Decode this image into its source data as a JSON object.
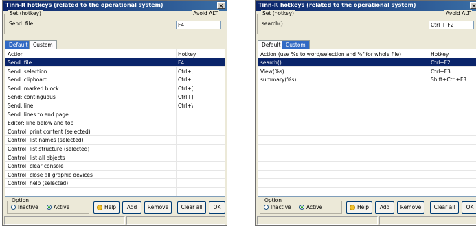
{
  "windows": [
    {
      "title": "Tinn-R hotkeys (related to the operational system)",
      "close_label": "×",
      "set_label": "Set (hotkey)",
      "avoid_label": "Avoid ALT",
      "send_text": "Send: file",
      "hotkey_value": "F4",
      "tabs": [
        {
          "label": "Default",
          "selected": true
        },
        {
          "label": "Custom",
          "selected": false
        }
      ],
      "columns": {
        "action": "Action",
        "hotkey": "Hotkey"
      },
      "rows": [
        {
          "action": "Send: file",
          "hotkey": "F4",
          "selected": true
        },
        {
          "action": "Send: selection",
          "hotkey": "Ctrl+,"
        },
        {
          "action": "Send: clipboard",
          "hotkey": "Ctrl+."
        },
        {
          "action": "Send: marked block",
          "hotkey": "Ctrl+["
        },
        {
          "action": "Send: continguous",
          "hotkey": "Ctrl+]"
        },
        {
          "action": "Send: line",
          "hotkey": "Ctrl+\\"
        },
        {
          "action": "Send: lines to end page",
          "hotkey": ""
        },
        {
          "action": "Editor: line below and top",
          "hotkey": ""
        },
        {
          "action": "Control: print content (selected)",
          "hotkey": ""
        },
        {
          "action": "Control: list names (selected)",
          "hotkey": ""
        },
        {
          "action": "Control: list structure (selected)",
          "hotkey": ""
        },
        {
          "action": "Control: list all objects",
          "hotkey": ""
        },
        {
          "action": "Control: clear console",
          "hotkey": ""
        },
        {
          "action": "Control: close all graphic devices",
          "hotkey": ""
        },
        {
          "action": "Control: help (selected)",
          "hotkey": ""
        },
        {
          "action": "",
          "hotkey": ""
        }
      ],
      "option": {
        "legend": "Option",
        "inactive": "Inactive",
        "active": "Active",
        "selected": "active"
      },
      "buttons": {
        "help": "Help",
        "add": "Add",
        "remove": "Remove",
        "clear_all": "Clear all",
        "ok": "OK"
      }
    },
    {
      "title": "Tinn-R hotkeys (related to the operational system)",
      "close_label": "×",
      "set_label": "Set (hotkey)",
      "avoid_label": "Avoid ALT",
      "send_text": "search()",
      "hotkey_value": "Ctrl + F2",
      "tabs": [
        {
          "label": "Default",
          "selected": false
        },
        {
          "label": "Custom",
          "selected": true
        }
      ],
      "columns": {
        "action": "Action (use %s to word/selection and %f for whole file)",
        "hotkey": "Hotkey"
      },
      "rows": [
        {
          "action": "search()",
          "hotkey": "Ctrl+F2",
          "selected": true
        },
        {
          "action": "View(%s)",
          "hotkey": "Ctrl+F3"
        },
        {
          "action": "summary(%s)",
          "hotkey": "Shift+Ctrl+F3"
        },
        {
          "action": "",
          "hotkey": ""
        },
        {
          "action": "",
          "hotkey": ""
        },
        {
          "action": "",
          "hotkey": ""
        },
        {
          "action": "",
          "hotkey": ""
        },
        {
          "action": "",
          "hotkey": ""
        },
        {
          "action": "",
          "hotkey": ""
        },
        {
          "action": "",
          "hotkey": ""
        },
        {
          "action": "",
          "hotkey": ""
        },
        {
          "action": "",
          "hotkey": ""
        },
        {
          "action": "",
          "hotkey": ""
        },
        {
          "action": "",
          "hotkey": ""
        },
        {
          "action": "",
          "hotkey": ""
        },
        {
          "action": "",
          "hotkey": ""
        }
      ],
      "option": {
        "legend": "Option",
        "inactive": "Inactive",
        "active": "Active",
        "selected": "active"
      },
      "buttons": {
        "help": "Help",
        "add": "Add",
        "remove": "Remove",
        "clear_all": "Clear all",
        "ok": "OK"
      }
    }
  ],
  "icons": {
    "help": "help-bulb-icon",
    "close": "close-icon"
  },
  "colors": {
    "title_bar": "#0a246a",
    "selection": "#0a246a",
    "tab_selected": "#316ac5",
    "window_bg": "#ece9d8"
  }
}
